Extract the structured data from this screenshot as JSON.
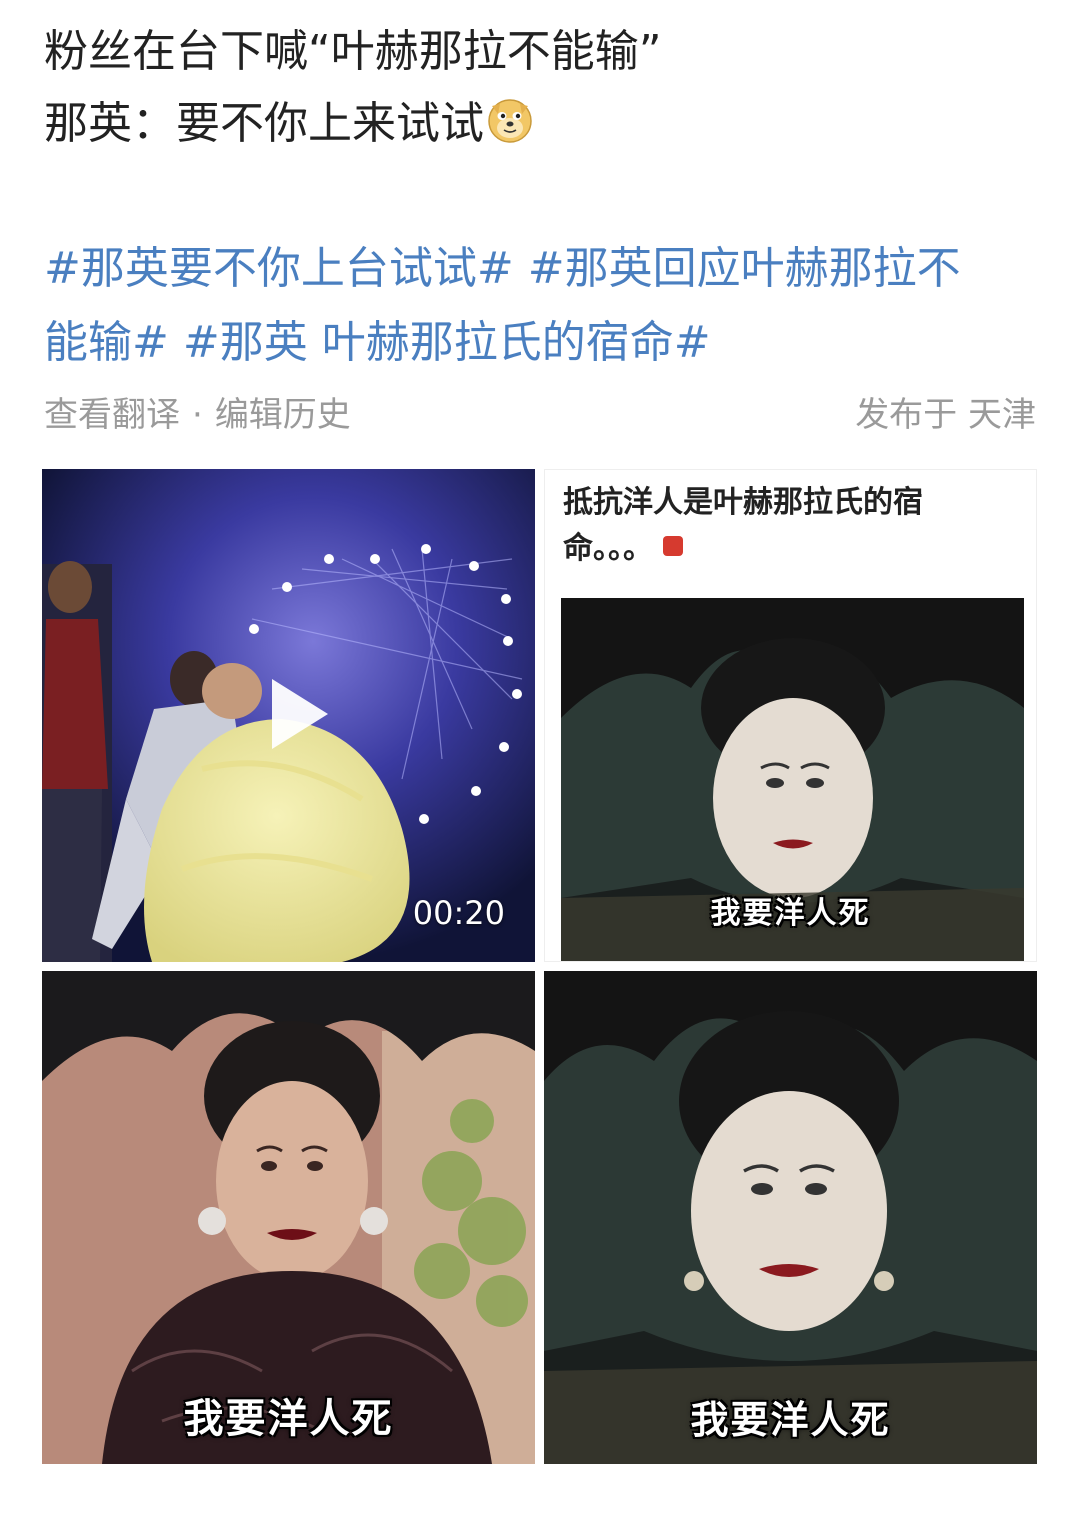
{
  "post": {
    "lines": [
      "粉丝在台下喊“叶赫那拉不能输”",
      "那英：要不你上来试试"
    ],
    "emoji": "doge-emoji"
  },
  "hashtags": [
    "#那英要不你上台试试#",
    "#那英回应叶赫那拉不",
    "能输#",
    "#那英 叶赫那拉氏的宿命#"
  ],
  "meta": {
    "translate": "查看翻译",
    "separator": "·",
    "edit_history": "编辑历史",
    "location": "发布于 天津"
  },
  "media": {
    "video": {
      "duration": "00:20",
      "play_icon": "play-icon"
    },
    "meme1": {
      "header_line1": "抵抗洋人是叶赫那拉氏的宿",
      "header_line2": "命。。。",
      "caption": "我要洋人死"
    },
    "meme2": {
      "caption": "我要洋人死"
    },
    "meme3": {
      "caption": "我要洋人死"
    }
  },
  "colors": {
    "text": "#222222",
    "hashtag": "#4a7fc0",
    "meta": "#9a9a9a"
  }
}
